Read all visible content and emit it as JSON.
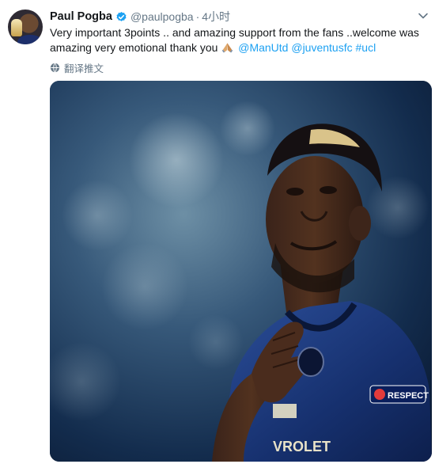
{
  "tweet": {
    "display_name": "Paul Pogba",
    "handle": "@paulpogba",
    "separator": "·",
    "time": "4小时",
    "text_line1": "Very important 3points .. and amazing support from the fans ..welcome was",
    "text_line2": "amazing very emotional thank you",
    "mention_1": "@ManUtd",
    "mention_2": "@juventusfc",
    "hashtag": "#ucl",
    "translate_label": "翻译推文",
    "media_text": {
      "sleeve_badge": "RESPECT",
      "shirt_sponsor": "VROLET"
    }
  },
  "icons": {
    "verified": "verified-badge-icon",
    "chevron": "chevron-down-icon",
    "globe": "globe-icon",
    "emoji": "folded-hands-emoji"
  },
  "colors": {
    "link": "#1da1f2",
    "text": "#14171a",
    "muted": "#657786",
    "verified": "#1da1f2"
  }
}
